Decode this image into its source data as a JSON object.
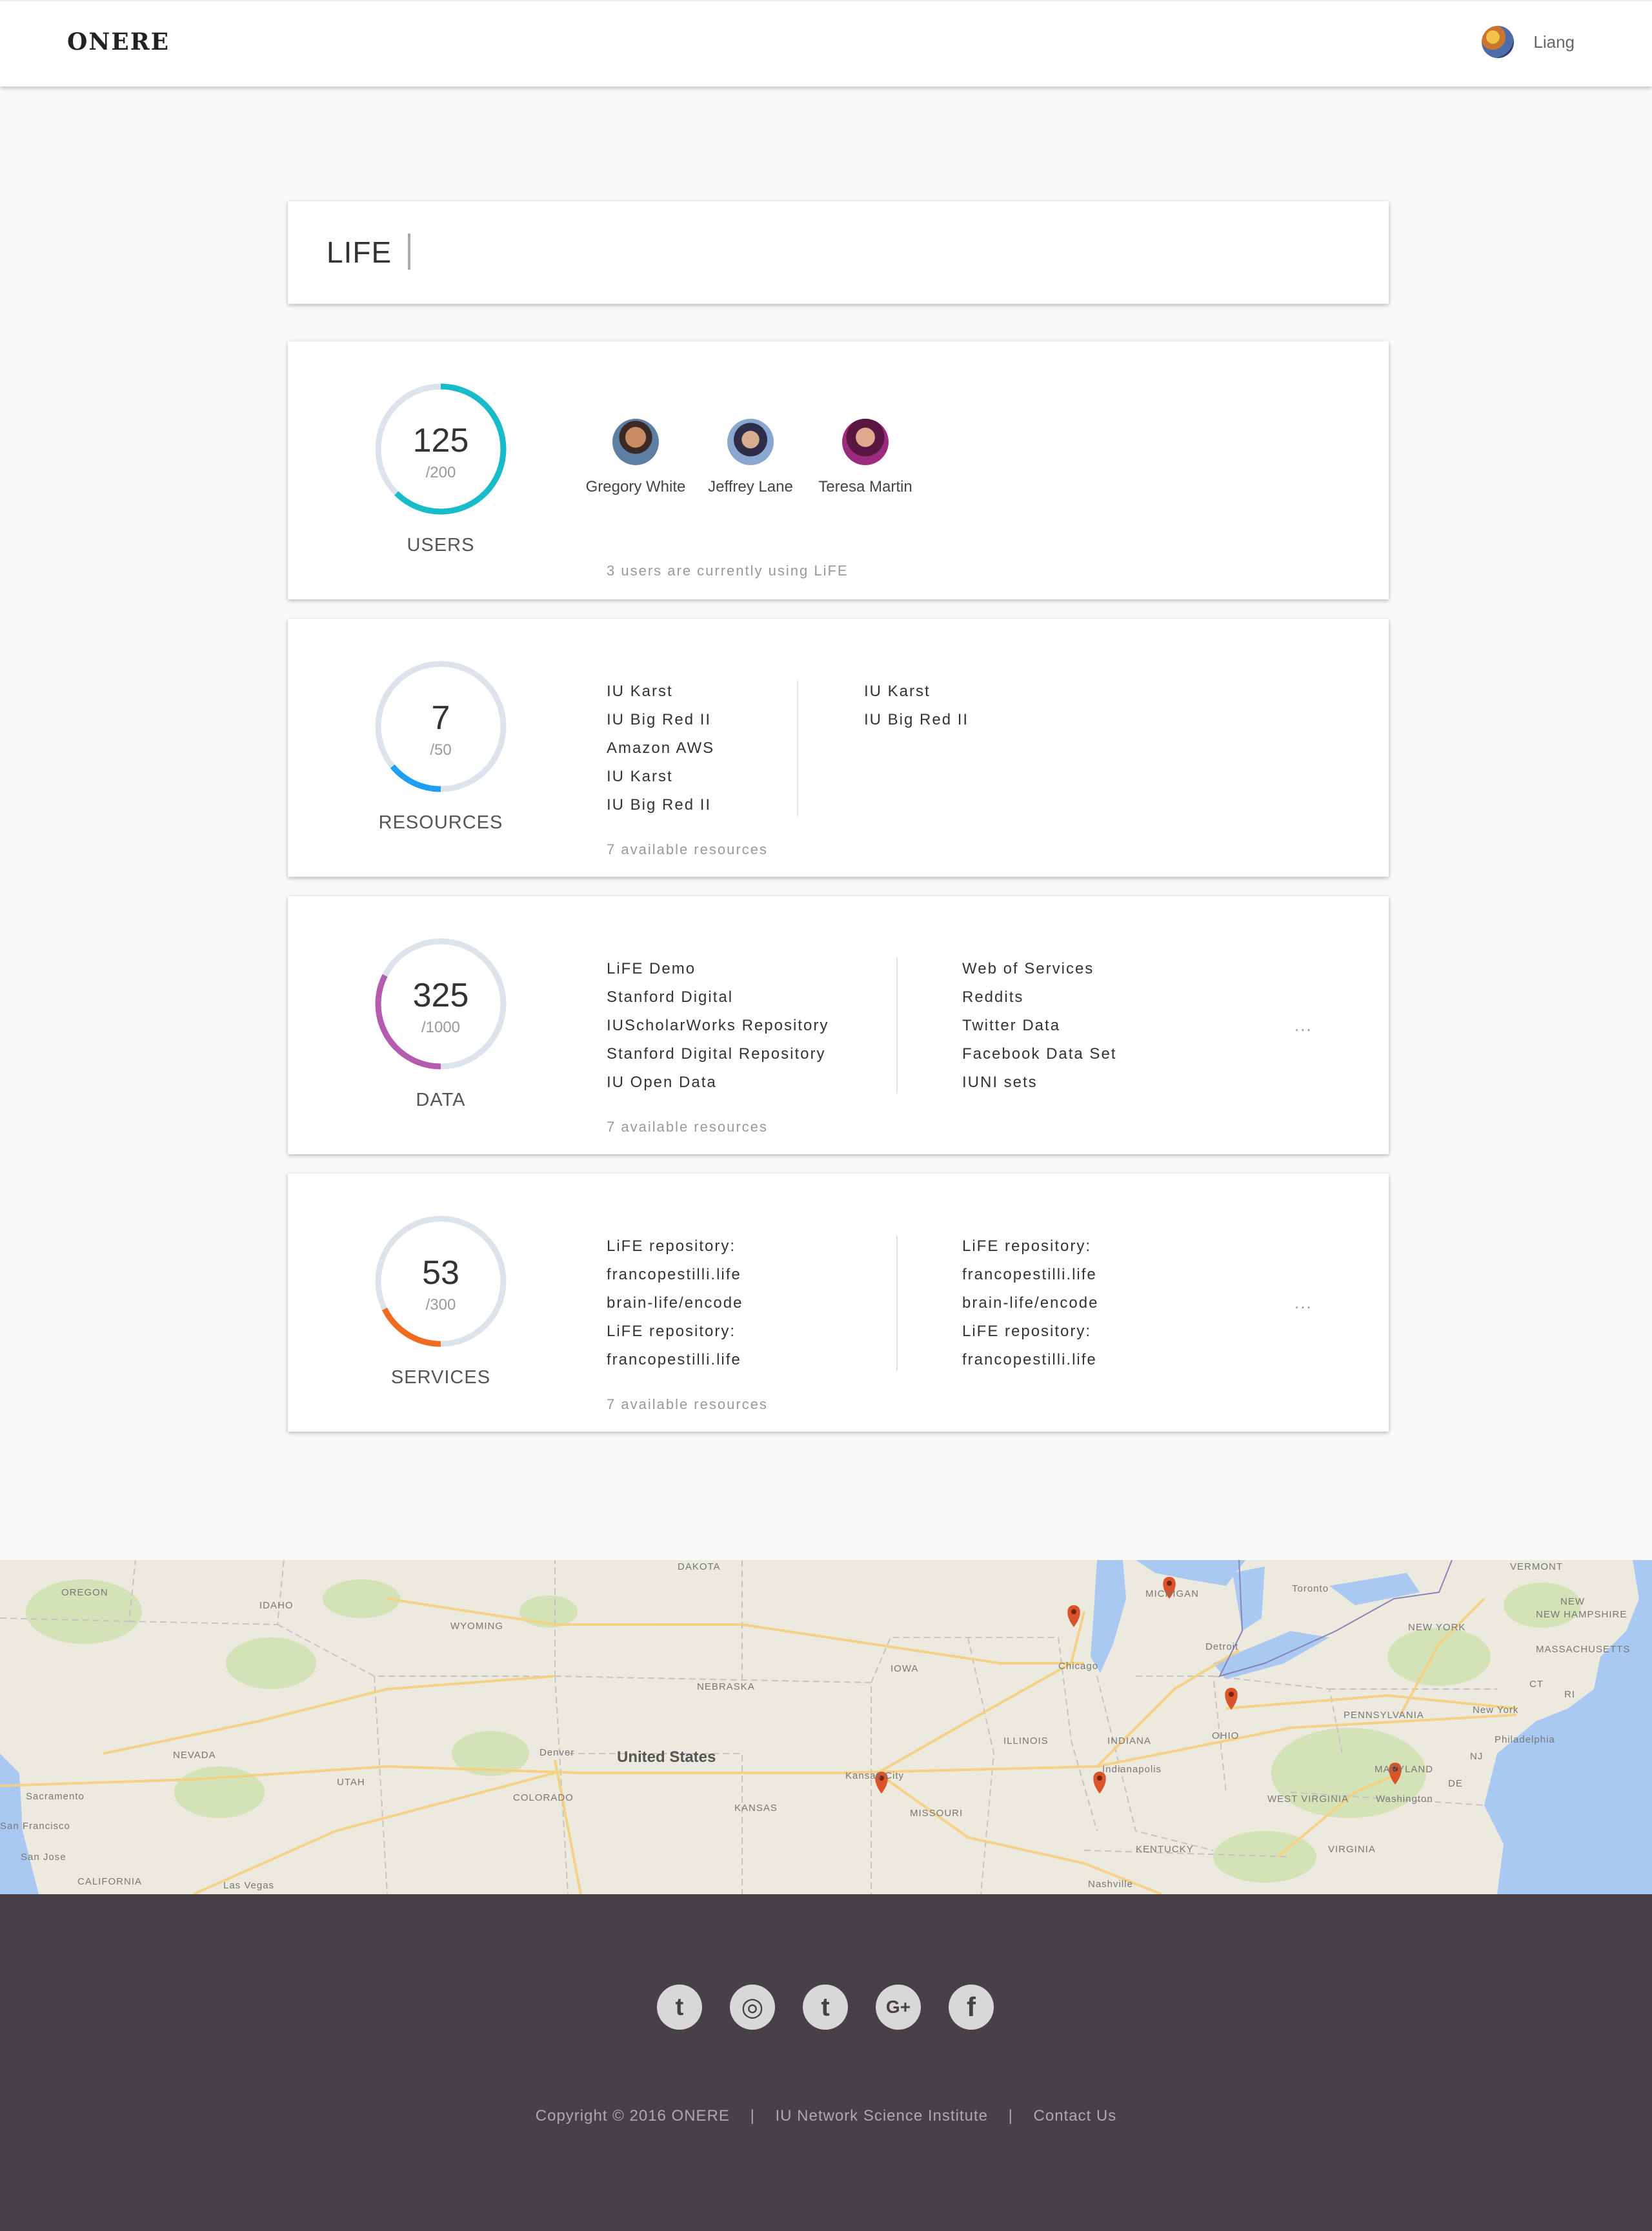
{
  "header": {
    "brand": "ONERE",
    "user_name": "Liang"
  },
  "page": {
    "title": "LIFE"
  },
  "users": {
    "count": "125",
    "total": "/200",
    "label": "USERS",
    "fraction": 0.625,
    "color": "#17bcc8",
    "list": [
      {
        "name": "Gregory White"
      },
      {
        "name": "Jeffrey Lane"
      },
      {
        "name": "Teresa Martin"
      }
    ],
    "note": "3 users are currently using LiFE"
  },
  "resources": {
    "count": "7",
    "total": "/50",
    "label": "RESOURCES",
    "fraction": 0.14,
    "color": "#1e9ff2",
    "col1": [
      "IU Karst",
      "IU Big Red II",
      "Amazon AWS",
      "IU Karst",
      "IU Big Red II"
    ],
    "col2": [
      "IU Karst",
      "IU Big Red II"
    ],
    "note": "7 available resources"
  },
  "data": {
    "count": "325",
    "total": "/1000",
    "label": "DATA",
    "fraction": 0.325,
    "color": "#b55bb0",
    "col1": [
      "LiFE Demo",
      "Stanford Digital",
      "IUScholarWorks Repository",
      "Stanford Digital Repository",
      "IU Open Data"
    ],
    "col2": [
      "Web of Services",
      "Reddits",
      "Twitter Data",
      "Facebook Data Set",
      "IUNI sets"
    ],
    "more": "...",
    "note": "7 available resources"
  },
  "services": {
    "count": "53",
    "total": "/300",
    "label": "SERVICES",
    "fraction": 0.177,
    "color": "#ef6b1e",
    "col1": [
      "LiFE repository:",
      "francopestilli.life",
      "brain-life/encode",
      "LiFE repository:",
      "francopestilli.life"
    ],
    "col2": [
      "LiFE repository:",
      "francopestilli.life",
      "brain-life/encode",
      "LiFE repository:",
      "francopestilli.life"
    ],
    "more": "...",
    "note": "7 available resources"
  },
  "map": {
    "country": "United States",
    "labels": [
      "OREGON",
      "IDAHO",
      "WYOMING",
      "NEVADA",
      "UTAH",
      "COLORADO",
      "NEBRASKA",
      "KANSAS",
      "IOWA",
      "MISSOURI",
      "ILLINOIS",
      "INDIANA",
      "KENTUCKY",
      "MICHIGAN",
      "NEW YORK",
      "PENNSYLVANIA",
      "WEST VIRGINIA",
      "VIRGINIA",
      "VERMONT",
      "NEW HAMPSHIRE",
      "MASSACHUSETTS",
      "NEW",
      "DAKOTA",
      "Sacramento",
      "San Francisco",
      "San Jose",
      "CALIFORNIA",
      "Las Vegas",
      "Denver",
      "Kansas City",
      "Chicago",
      "Indianapolis",
      "Detroit",
      "Toronto",
      "Philadelphia",
      "New York",
      "Washington",
      "Nashville",
      "OHIO",
      "MARYLAND",
      "NJ",
      "DE",
      "CT",
      "RI"
    ],
    "marker_color": "#d9532b"
  },
  "footer": {
    "socials": [
      {
        "icon": "twitter-icon",
        "glyph": "t"
      },
      {
        "icon": "instagram-icon",
        "glyph": "◎"
      },
      {
        "icon": "tumblr-icon",
        "glyph": "t"
      },
      {
        "icon": "google-plus-icon",
        "glyph": "G+"
      },
      {
        "icon": "facebook-icon",
        "glyph": "f"
      }
    ],
    "copyright": "Copyright © 2016  ONERE",
    "separator": "|",
    "link1": "IU Network Science Institute",
    "link2": "Contact Us"
  }
}
